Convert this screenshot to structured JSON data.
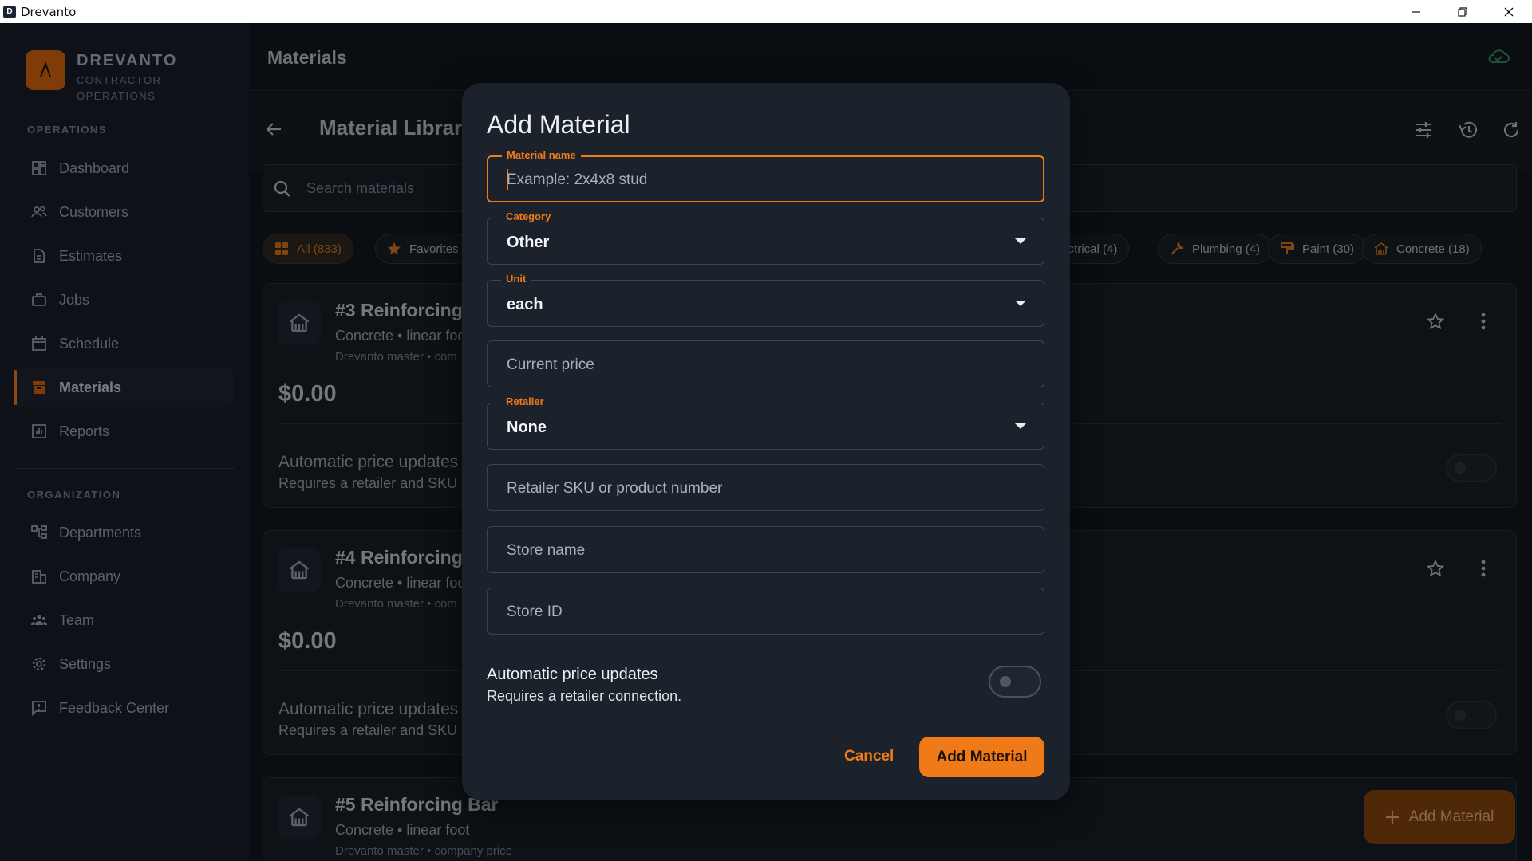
{
  "window": {
    "title": "Drevanto",
    "icon_letter": "D"
  },
  "brand": {
    "name": "DREVANTO",
    "subtitle_line1": "CONTRACTOR",
    "subtitle_line2": "OPERATIONS"
  },
  "sidebar": {
    "operations_label": "OPERATIONS",
    "operations": [
      {
        "label": "Dashboard",
        "icon": "dashboard-icon"
      },
      {
        "label": "Customers",
        "icon": "customers-icon"
      },
      {
        "label": "Estimates",
        "icon": "estimates-icon"
      },
      {
        "label": "Jobs",
        "icon": "jobs-icon"
      },
      {
        "label": "Schedule",
        "icon": "schedule-icon"
      },
      {
        "label": "Materials",
        "icon": "materials-icon",
        "active": true
      },
      {
        "label": "Reports",
        "icon": "reports-icon"
      }
    ],
    "organization_label": "ORGANIZATION",
    "organization": [
      {
        "label": "Departments",
        "icon": "departments-icon"
      },
      {
        "label": "Company",
        "icon": "company-icon"
      },
      {
        "label": "Team",
        "icon": "team-icon"
      },
      {
        "label": "Settings",
        "icon": "settings-icon"
      },
      {
        "label": "Feedback Center",
        "icon": "feedback-icon"
      }
    ]
  },
  "header": {
    "page_title": "Materials"
  },
  "library": {
    "title": "Material Library",
    "search_placeholder": "Search materials"
  },
  "filters": [
    {
      "label": "All (833)",
      "selected": true
    },
    {
      "label": "Favorites"
    },
    {
      "label": "lectrical (4)"
    },
    {
      "label": "Plumbing (4)"
    },
    {
      "label": "Paint (30)"
    },
    {
      "label": "Concrete (18)"
    }
  ],
  "materials": [
    {
      "name": "#3 Reinforcing",
      "meta": "Concrete • linear foo",
      "source": "Drevanto master • com",
      "price": "$0.00",
      "auto_label": "Automatic price updates",
      "auto_requirement": "Requires a retailer and SKU"
    },
    {
      "name": "#4 Reinforcing",
      "meta": "Concrete • linear foo",
      "source": "Drevanto master • com",
      "price": "$0.00",
      "auto_label": "Automatic price updates",
      "auto_requirement": "Requires a retailer and SKU"
    },
    {
      "name": "#5 Reinforcing Bar",
      "meta": "Concrete • linear foot",
      "source": "Drevanto master • company price"
    }
  ],
  "fab": {
    "label": "Add Material"
  },
  "dialog": {
    "title": "Add Material",
    "material_name": {
      "label": "Material name",
      "placeholder": "Example: 2x4x8 stud"
    },
    "category": {
      "label": "Category",
      "value": "Other"
    },
    "unit": {
      "label": "Unit",
      "value": "each"
    },
    "current_price": {
      "placeholder": "Current price"
    },
    "retailer": {
      "label": "Retailer",
      "value": "None"
    },
    "retailer_sku": {
      "placeholder": "Retailer SKU or product number"
    },
    "store_name": {
      "placeholder": "Store name"
    },
    "store_id": {
      "placeholder": "Store ID"
    },
    "auto_updates": {
      "label": "Automatic price updates",
      "requirement": "Requires a retailer connection.",
      "enabled": false
    },
    "cancel_label": "Cancel",
    "submit_label": "Add Material"
  },
  "colors": {
    "accent": "#f07a17",
    "background": "#10161d",
    "sidebar": "#161d26",
    "dialog": "#1b222b"
  }
}
